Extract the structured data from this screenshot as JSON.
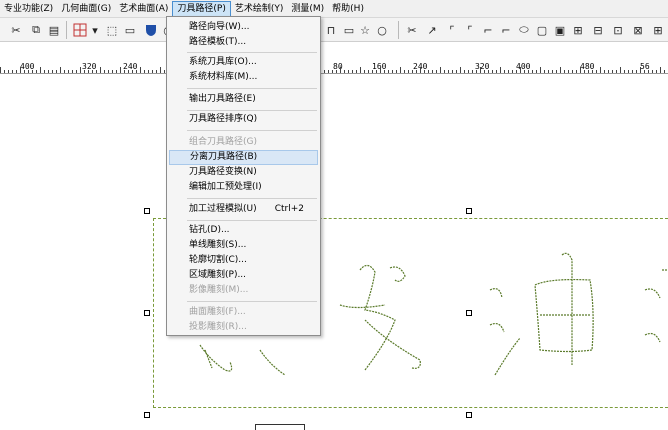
{
  "menubar": {
    "items": [
      {
        "label": "专业功能(Z)"
      },
      {
        "label": "几何曲面(G)"
      },
      {
        "label": "艺术曲面(A)"
      },
      {
        "label": "刀具路径(P)"
      },
      {
        "label": "艺术绘制(Y)"
      },
      {
        "label": "测量(M)"
      },
      {
        "label": "帮助(H)"
      }
    ]
  },
  "ruler": {
    "labels": [
      "400",
      "320",
      "240",
      "80",
      "160",
      "240",
      "320",
      "400",
      "480",
      "56"
    ]
  },
  "dropdown": {
    "items": [
      {
        "label": "路径向导(W)...",
        "disabled": false
      },
      {
        "label": "路径模板(T)...",
        "disabled": false
      },
      {
        "label": "系统刀具库(O)...",
        "disabled": false
      },
      {
        "label": "系统材料库(M)...",
        "disabled": false
      },
      {
        "label": "输出刀具路径(E)",
        "disabled": false
      },
      {
        "label": "刀具路径排序(Q)",
        "disabled": false
      },
      {
        "label": "组合刀具路径(G)",
        "disabled": true
      },
      {
        "label": "分离刀具路径(B)",
        "disabled": false
      },
      {
        "label": "刀具路径变换(N)",
        "disabled": false
      },
      {
        "label": "编辑加工预处理(I)",
        "disabled": false
      },
      {
        "label": "加工过程模拟(U)",
        "shortcut": "Ctrl+2",
        "disabled": false
      },
      {
        "label": "钻孔(D)...",
        "disabled": false
      },
      {
        "label": "单线雕刻(S)...",
        "disabled": false
      },
      {
        "label": "轮廓切割(C)...",
        "disabled": false
      },
      {
        "label": "区域雕刻(P)...",
        "disabled": false
      },
      {
        "label": "影像雕刻(M)...",
        "disabled": true
      },
      {
        "label": "曲面雕刻(F)...",
        "disabled": true
      },
      {
        "label": "投影雕刻(R)...",
        "disabled": true
      }
    ]
  }
}
